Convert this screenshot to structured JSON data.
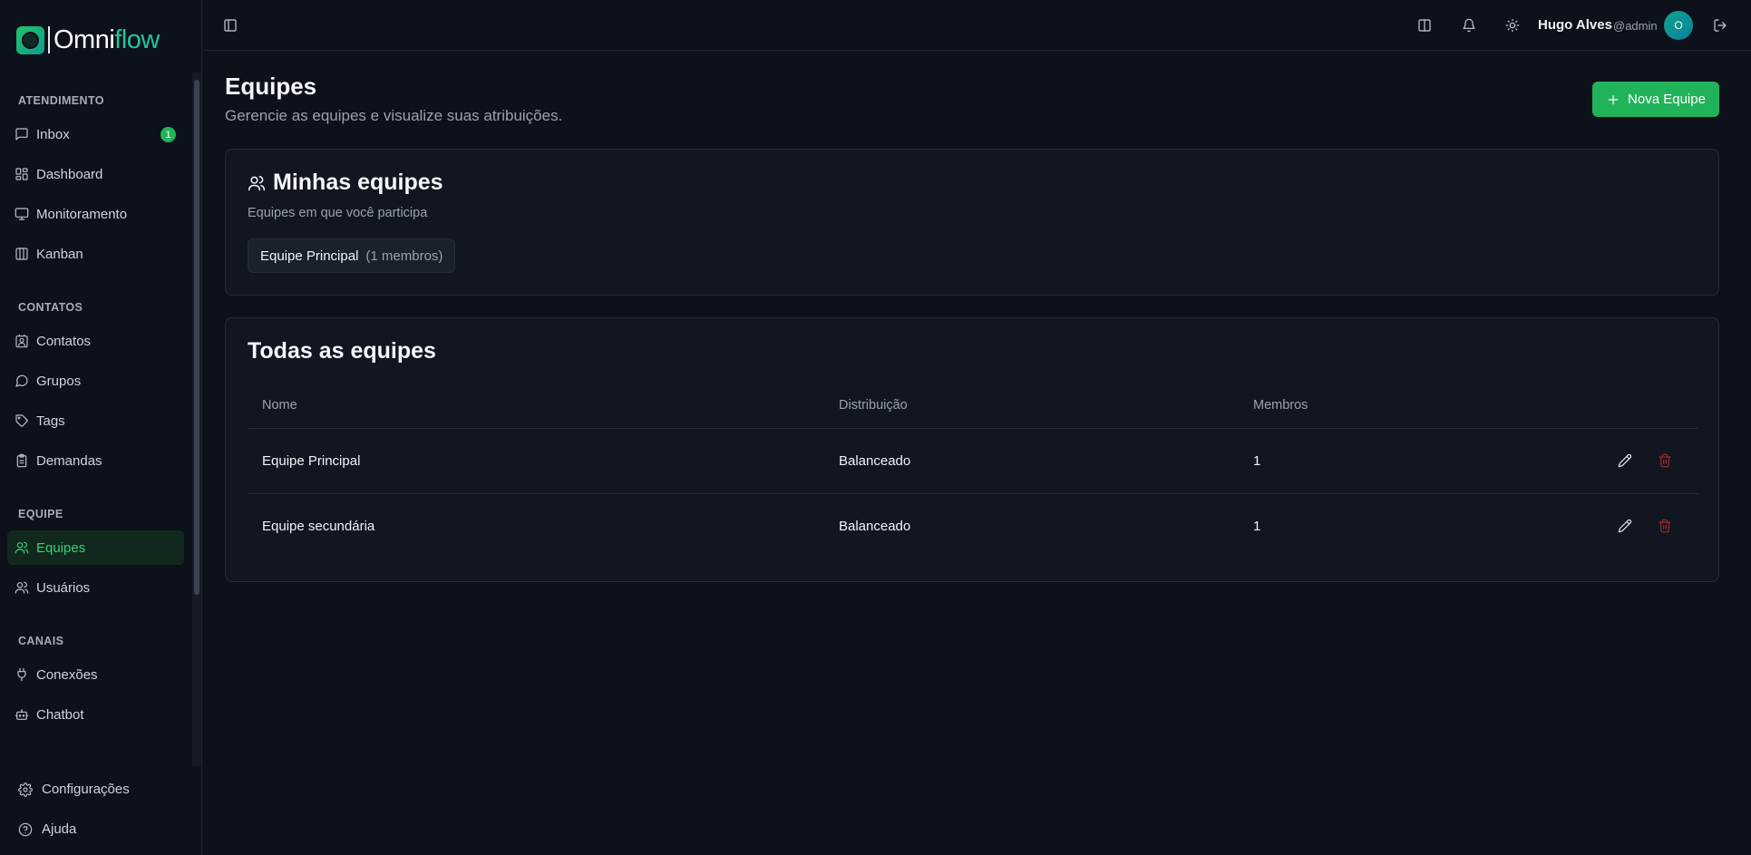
{
  "app": {
    "logo_left": "Omni",
    "logo_right": "flow"
  },
  "sidebar": {
    "sections": [
      {
        "label": "ATENDIMENTO"
      },
      {
        "label": "CONTATOS"
      },
      {
        "label": "EQUIPE"
      },
      {
        "label": "CANAIS"
      }
    ],
    "items": [
      {
        "label": "Inbox",
        "icon": "message-square-icon",
        "badge": "1"
      },
      {
        "label": "Dashboard",
        "icon": "layout-dashboard-icon"
      },
      {
        "label": "Monitoramento",
        "icon": "monitor-icon"
      },
      {
        "label": "Kanban",
        "icon": "columns-icon"
      },
      {
        "label": "Contatos",
        "icon": "contact-icon"
      },
      {
        "label": "Grupos",
        "icon": "message-circle-icon"
      },
      {
        "label": "Tags",
        "icon": "tag-icon"
      },
      {
        "label": "Demandas",
        "icon": "clipboard-icon"
      },
      {
        "label": "Equipes",
        "icon": "users-icon",
        "active": true
      },
      {
        "label": "Usuários",
        "icon": "user-icon"
      },
      {
        "label": "Conexões",
        "icon": "plug-icon"
      },
      {
        "label": "Chatbot",
        "icon": "bot-icon"
      }
    ],
    "bottom": [
      {
        "label": "Configurações",
        "icon": "settings-icon"
      },
      {
        "label": "Ajuda",
        "icon": "help-circle-icon"
      }
    ]
  },
  "header": {
    "user_name": "Hugo Alves",
    "user_handle": "@admin",
    "avatar_initial": "O"
  },
  "page": {
    "title": "Equipes",
    "subtitle": "Gerencie as equipes e visualize suas atribuições.",
    "new_button": "Nova Equipe"
  },
  "my_teams": {
    "title": "Minhas equipes",
    "description": "Equipes em que você participa",
    "chips": [
      {
        "name": "Equipe Principal",
        "count": "(1 membros)"
      }
    ]
  },
  "all_teams": {
    "title": "Todas as equipes",
    "columns": [
      "Nome",
      "Distribuição",
      "Membros"
    ],
    "rows": [
      {
        "name": "Equipe Principal",
        "distribution": "Balanceado",
        "members": "1"
      },
      {
        "name": "Equipe secundária",
        "distribution": "Balanceado",
        "members": "1"
      }
    ]
  },
  "colors": {
    "accent": "#21b35a",
    "background": "#0d111a",
    "card": "#111620",
    "danger": "#a3292c"
  }
}
